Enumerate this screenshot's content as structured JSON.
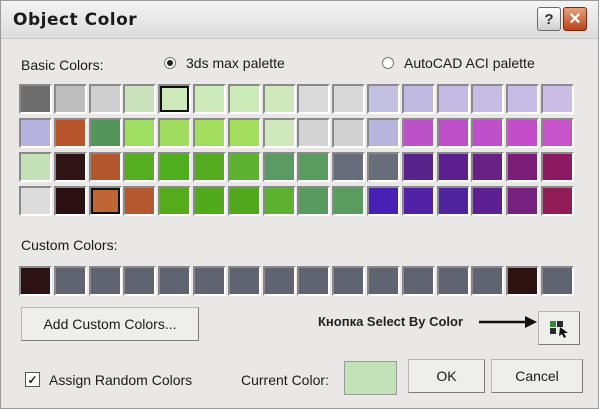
{
  "window": {
    "title": "Object Color",
    "help_glyph": "?",
    "close_glyph": "✕"
  },
  "basic_colors_label": "Basic Colors:",
  "palette_options": [
    {
      "label": "3ds max palette",
      "selected": true
    },
    {
      "label": "AutoCAD ACI palette",
      "selected": false
    }
  ],
  "basic_colors": [
    [
      "#6e6e6e",
      "#bdbdbd",
      "#cfcfcf",
      "#cbe3bd",
      "#cde9b9",
      "#cbe9b9",
      "#cbeab8",
      "#cfe9bd",
      "#dadada",
      "#d8d8d8",
      "#c3c0e0",
      "#c0bae2",
      "#c3bae4",
      "#c5bce4",
      "#c7bce6",
      "#cbbde6"
    ],
    [
      "#b6b2de",
      "#b8542c",
      "#54955c",
      "#a1df62",
      "#a0dc5f",
      "#a2dd5f",
      "#a3de5e",
      "#cfe9bd",
      "#d3d3d3",
      "#d1d1d1",
      "#b9b4de",
      "#bb52c8",
      "#be4fc9",
      "#c04fcb",
      "#c44ec9",
      "#c653c7"
    ],
    [
      "#c4e0b7",
      "#2e1414",
      "#b4572e",
      "#54ae20",
      "#4fae1d",
      "#54ab1f",
      "#5db231",
      "#5c9a63",
      "#5a9b60",
      "#676d7a",
      "#696e7a",
      "#58228b",
      "#5b208d",
      "#6a2186",
      "#7c1d77",
      "#8c1a62"
    ],
    [
      "#dcdcdc",
      "#2a1010",
      "#c06534",
      "#b5582f",
      "#55ab1b",
      "#51a91c",
      "#52a81c",
      "#5eb22f",
      "#599a5f",
      "#5a9b5e",
      "#4820b6",
      "#5222a6",
      "#50239f",
      "#5d1f94",
      "#78207f",
      "#921c56"
    ]
  ],
  "selected_basic": [
    {
      "row": 0,
      "col": 4
    },
    {
      "row": 3,
      "col": 2
    }
  ],
  "custom_colors_label": "Custom Colors:",
  "custom_colors": [
    "#2c1212",
    "#606470",
    "#606470",
    "#606470",
    "#606470",
    "#606470",
    "#606470",
    "#606470",
    "#606470",
    "#606470",
    "#606470",
    "#606470",
    "#606470",
    "#606470",
    "#2e1212",
    "#606470"
  ],
  "add_custom_label": "Add Custom Colors...",
  "annotation_text": "Кнопка Select By Color",
  "assign_random": {
    "label": "Assign Random Colors",
    "checked": true,
    "mark": "✓"
  },
  "current_color_label": "Current Color:",
  "current_color": "#c3e2b8",
  "ok_label": "OK",
  "cancel_label": "Cancel",
  "select_by_color_icon": "select-by-color-icon"
}
